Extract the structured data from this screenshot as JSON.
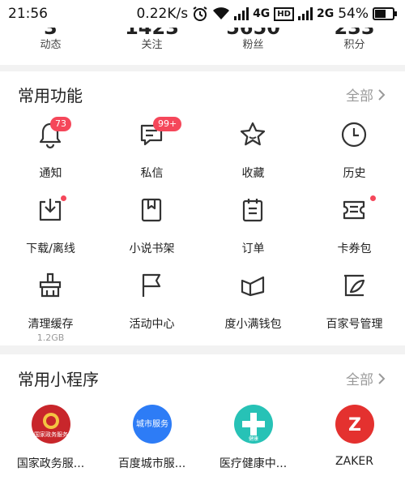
{
  "status_bar": {
    "time": "21:56",
    "speed": "0.22K/s",
    "network_1": "4G",
    "hd_label": "HD",
    "network_2": "2G",
    "battery": "54%"
  },
  "stats": [
    {
      "label": "动态"
    },
    {
      "label": "关注"
    },
    {
      "label": "粉丝"
    },
    {
      "label": "积分"
    }
  ],
  "common_functions": {
    "title": "常用功能",
    "more": "全部",
    "items": [
      {
        "label": "通知",
        "icon": "bell-icon",
        "badge": "73"
      },
      {
        "label": "私信",
        "icon": "message-icon",
        "badge": "99+"
      },
      {
        "label": "收藏",
        "icon": "star-icon"
      },
      {
        "label": "历史",
        "icon": "clock-icon"
      },
      {
        "label": "下载/离线",
        "icon": "download-icon",
        "dot": true
      },
      {
        "label": "小说书架",
        "icon": "book-icon"
      },
      {
        "label": "订单",
        "icon": "order-icon"
      },
      {
        "label": "卡券包",
        "icon": "coupon-icon",
        "dot": true
      },
      {
        "label": "清理缓存",
        "icon": "broom-icon",
        "sub": "1.2GB"
      },
      {
        "label": "活动中心",
        "icon": "flag-icon"
      },
      {
        "label": "度小满钱包",
        "icon": "wallet-icon"
      },
      {
        "label": "百家号管理",
        "icon": "baijiahao-icon"
      }
    ]
  },
  "mini_programs": {
    "title": "常用小程序",
    "more": "全部",
    "items": [
      {
        "label": "国家政务服...",
        "icon": "national-emblem-icon",
        "color": "#c8262b",
        "inner_text": "国家政务服务"
      },
      {
        "label": "百度城市服...",
        "icon": "city-service-icon",
        "color": "#2d7cf6",
        "inner_text": "城市服务"
      },
      {
        "label": "医疗健康中...",
        "icon": "medical-cross-icon",
        "color": "#27c2b6",
        "inner_text": "健康"
      },
      {
        "label": "ZAKER",
        "icon": "zaker-icon",
        "color": "#e4312f",
        "inner_text": "Z"
      }
    ]
  },
  "colors": {
    "accent": "#f5475a",
    "muted": "#9a9a9a",
    "background": "#f2f2f2"
  }
}
